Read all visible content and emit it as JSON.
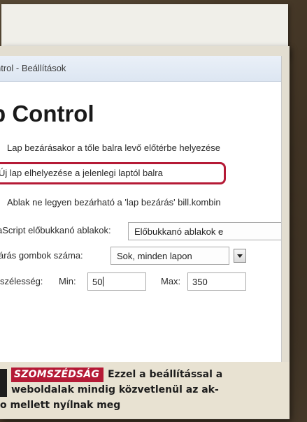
{
  "window": {
    "title": "ntrol - Beállítások"
  },
  "heading": "b Control",
  "options": [
    {
      "text": "Lap bezárásakor a tőle balra levő előtérbe helyezése"
    },
    {
      "text": "Új lap elhelyezése a jelenlegi laptól balra",
      "highlighted": true
    },
    {
      "text": "Ablak ne legyen bezárható a 'lap bezárás' bill.kombin"
    }
  ],
  "popups": {
    "label": "aScript előbukkanó ablakok:",
    "value": "Előbukkanó ablakok e"
  },
  "close_buttons": {
    "label": "árás gombok száma:",
    "value": "Sok, minden lapon"
  },
  "width": {
    "label": "szélesség:",
    "min_label": "Min:",
    "min_value": "50",
    "max_label": "Max:",
    "max_value": "350"
  },
  "caption": {
    "tag": "SZOMSZÉDSÁG",
    "line1": "Ezzel a beállítással a",
    "line2": "weboldalak mindig közvetlenül az ak-",
    "line3": "o mellett nyílnak meg"
  },
  "colors": {
    "accent": "#b51a36",
    "titlebar": "#dde6f2"
  }
}
